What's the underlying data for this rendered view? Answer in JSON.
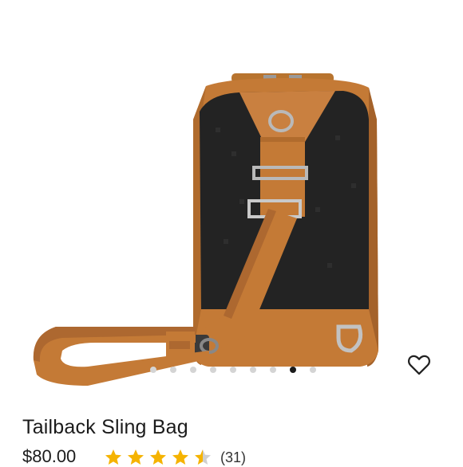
{
  "product": {
    "name": "Tailback Sling Bag",
    "price": "$80.00",
    "rating": 4.5,
    "review_count": "(31)"
  },
  "gallery": {
    "slide_count": 9,
    "active_slide": 7
  },
  "icons": {
    "favorite": "heart-outline-icon",
    "star": "star-icon"
  },
  "colors": {
    "star": "#f5b301",
    "active_dot": "#1a1a1a",
    "inactive_dot": "#d4d4d4"
  }
}
